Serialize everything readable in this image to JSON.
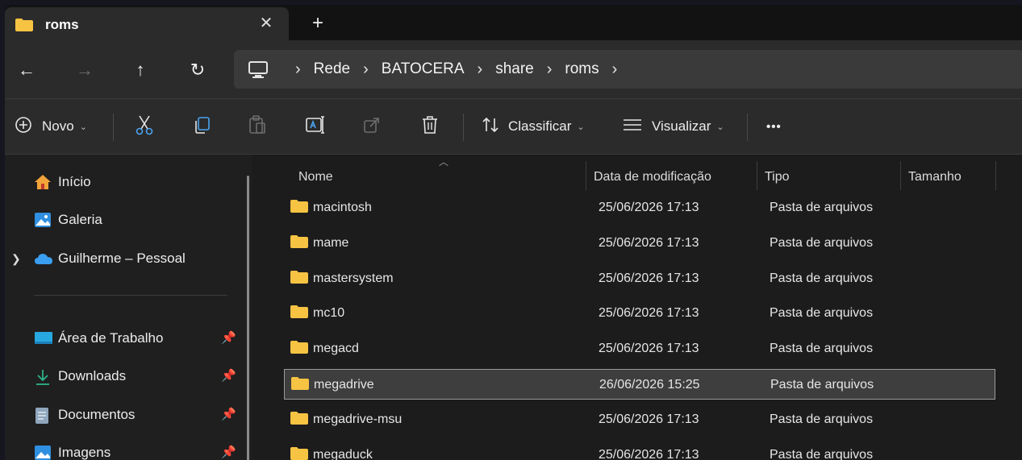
{
  "tab": {
    "title": "roms",
    "close": "✕",
    "new_tab": "+"
  },
  "nav": {
    "back": "←",
    "forward": "→",
    "up": "↑",
    "refresh": "↻"
  },
  "breadcrumbs": [
    "Rede",
    "BATOCERA",
    "share",
    "roms"
  ],
  "breadcrumb_sep": "›",
  "toolbar": {
    "new_label": "Novo",
    "sort_label": "Classificar",
    "view_label": "Visualizar",
    "more": "•••"
  },
  "sidebar": {
    "quick": [
      {
        "label": "Início",
        "icon": "home-icon"
      },
      {
        "label": "Galeria",
        "icon": "gallery-icon"
      },
      {
        "label": "Guilherme – Pessoal",
        "icon": "onedrive-cloud-icon"
      }
    ],
    "pinned": [
      {
        "label": "Área de Trabalho",
        "icon": "desktop-icon"
      },
      {
        "label": "Downloads",
        "icon": "download-icon"
      },
      {
        "label": "Documentos",
        "icon": "document-icon"
      },
      {
        "label": "Imagens",
        "icon": "image-icon"
      }
    ]
  },
  "columns": {
    "name": "Nome",
    "date": "Data de modificação",
    "type": "Tipo",
    "size": "Tamanho"
  },
  "files": [
    {
      "name": "macintosh",
      "date": "25/06/2026 17:13",
      "type": "Pasta de arquivos"
    },
    {
      "name": "mame",
      "date": "25/06/2026 17:13",
      "type": "Pasta de arquivos"
    },
    {
      "name": "mastersystem",
      "date": "25/06/2026 17:13",
      "type": "Pasta de arquivos"
    },
    {
      "name": "mc10",
      "date": "25/06/2026 17:13",
      "type": "Pasta de arquivos"
    },
    {
      "name": "megacd",
      "date": "25/06/2026 17:13",
      "type": "Pasta de arquivos"
    },
    {
      "name": "megadrive",
      "date": "26/06/2026 15:25",
      "type": "Pasta de arquivos"
    },
    {
      "name": "megadrive-msu",
      "date": "25/06/2026 17:13",
      "type": "Pasta de arquivos"
    },
    {
      "name": "megaduck",
      "date": "25/06/2026 17:13",
      "type": "Pasta de arquivos"
    }
  ],
  "selected_file": "megadrive",
  "colors": {
    "folder": "#f6c343",
    "accent": "#4aa3f0"
  }
}
